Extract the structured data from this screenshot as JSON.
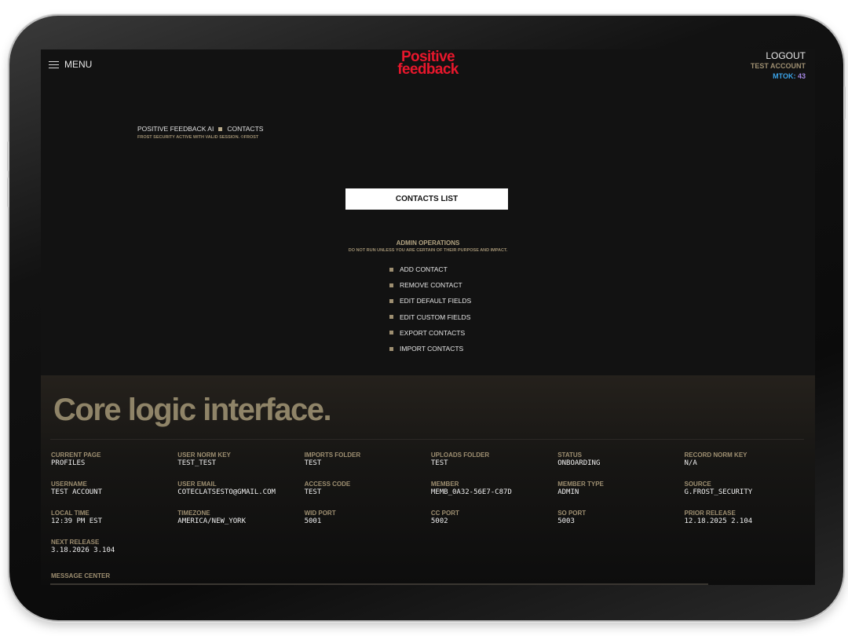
{
  "header": {
    "menu_label": "MENU",
    "logo_line1": "Positive",
    "logo_line2": "feedback",
    "logout_label": "LOGOUT",
    "account_name": "TEST ACCOUNT",
    "mtok_label": "MTOK:",
    "mtok_value": "43"
  },
  "breadcrumb": {
    "root": "POSITIVE FEEDBACK AI",
    "current": "CONTACTS",
    "session_note": "FROST SECURITY ACTIVE WITH VALID SESSION. ©FROST"
  },
  "main": {
    "contacts_button": "CONTACTS LIST",
    "admin_title": "ADMIN OPERATIONS",
    "admin_warning": "DO NOT RUN UNLESS YOU ARE CERTAIN OF THEIR PURPOSE AND IMPACT.",
    "operations": [
      "ADD CONTACT",
      "REMOVE CONTACT",
      "EDIT DEFAULT FIELDS",
      "EDIT CUSTOM FIELDS",
      "EXPORT CONTACTS",
      "IMPORT CONTACTS"
    ]
  },
  "panel": {
    "title": "Core logic interface.",
    "fields": [
      {
        "label": "CURRENT PAGE",
        "value": "PROFILES"
      },
      {
        "label": "USER NORM KEY",
        "value": "TEST_TEST"
      },
      {
        "label": "IMPORTS FOLDER",
        "value": "TEST"
      },
      {
        "label": "UPLOADS FOLDER",
        "value": "TEST"
      },
      {
        "label": "STATUS",
        "value": "ONBOARDING"
      },
      {
        "label": "RECORD NORM KEY",
        "value": "N/A"
      },
      {
        "label": "USERNAME",
        "value": "TEST ACCOUNT"
      },
      {
        "label": "USER EMAIL",
        "value": "COTECLATSESTO@GMAIL.COM"
      },
      {
        "label": "ACCESS CODE",
        "value": "TEST"
      },
      {
        "label": "MEMBER",
        "value": "MEMB_0A32-56E7-C87D"
      },
      {
        "label": "MEMBER TYPE",
        "value": "ADMIN"
      },
      {
        "label": "SOURCE",
        "value": "G.FROST_SECURITY"
      },
      {
        "label": "LOCAL TIME",
        "value": "12:39 PM EST"
      },
      {
        "label": "TIMEZONE",
        "value": "AMERICA/NEW_YORK"
      },
      {
        "label": "WID PORT",
        "value": "5001"
      },
      {
        "label": "CC PORT",
        "value": "5002"
      },
      {
        "label": "SO PORT",
        "value": "5003"
      },
      {
        "label": "PRIOR RELEASE",
        "value": "12.18.2025 2.104"
      },
      {
        "label": "NEXT RELEASE",
        "value": "3.18.2026 3.104"
      }
    ],
    "message_center_label": "MESSAGE CENTER"
  },
  "colors": {
    "accent_red": "#e8172c",
    "tan": "#9e8f71",
    "mtok_blue": "#3ba3e8",
    "mtok_purple": "#a287e0",
    "background": "#121212"
  }
}
